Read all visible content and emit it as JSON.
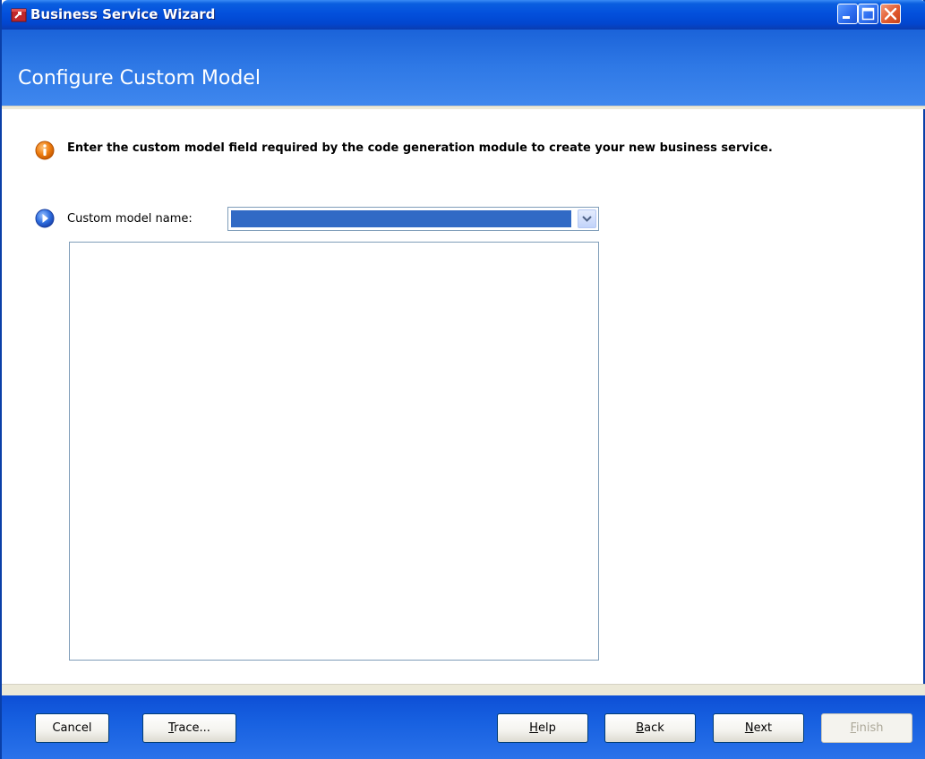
{
  "window": {
    "title": "Business Service Wizard"
  },
  "header": {
    "title": "Configure Custom Model"
  },
  "content": {
    "info_text": "Enter the custom model field required by the code generation module to create your new business service.",
    "field_label": "Custom model name:",
    "combo_value": "",
    "list_items": []
  },
  "footer": {
    "buttons": [
      {
        "label": "Cancel",
        "mnemonic": "",
        "enabled": true
      },
      {
        "label": "Trace...",
        "mnemonic": "T",
        "enabled": true
      },
      {
        "label": "Help",
        "mnemonic": "H",
        "enabled": true
      },
      {
        "label": "Back",
        "mnemonic": "B",
        "enabled": true
      },
      {
        "label": "Next",
        "mnemonic": "N",
        "enabled": true
      },
      {
        "label": "Finish",
        "mnemonic": "F",
        "enabled": false
      }
    ]
  },
  "icons": {
    "app": "wizard-app-icon",
    "info": "info-icon",
    "field": "arrow-right-icon",
    "dropdown": "chevron-down-icon"
  },
  "colors": {
    "titlebar": "#0350dc",
    "header": "#2f79e6",
    "selection": "#316ac5",
    "footer": "#1760e0"
  }
}
